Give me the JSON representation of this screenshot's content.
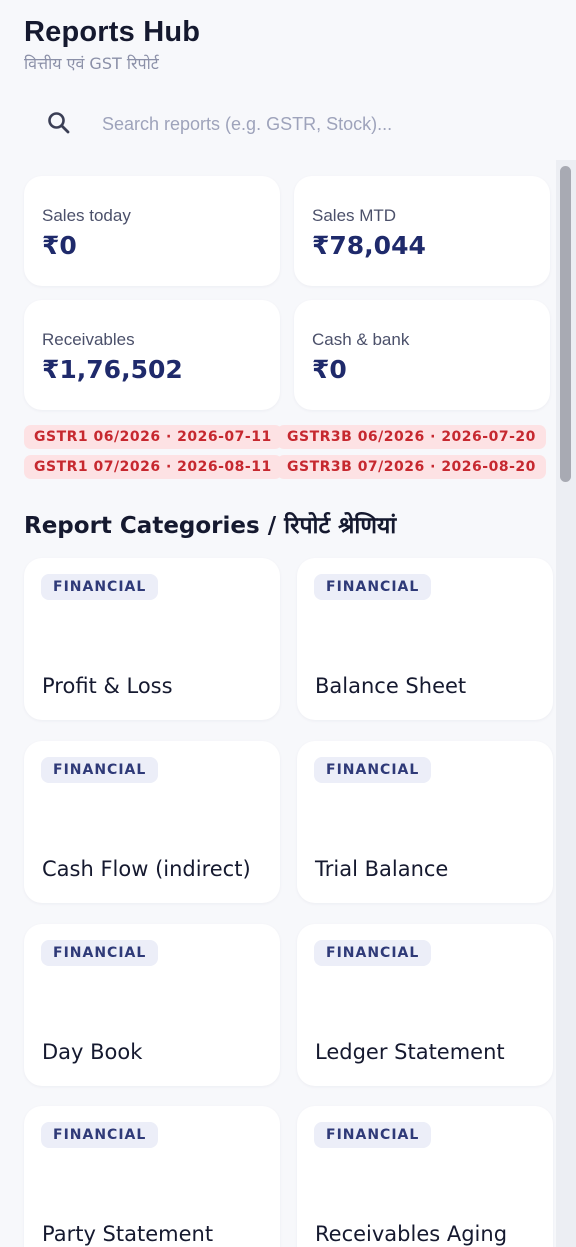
{
  "header": {
    "title": "Reports Hub",
    "subtitle": "वित्तीय एवं GST रिपोर्ट"
  },
  "search": {
    "placeholder": "Search reports (e.g. GSTR, Stock)...",
    "value": ""
  },
  "stats": [
    {
      "label": "Sales today",
      "value": "₹0"
    },
    {
      "label": "Sales MTD",
      "value": "₹78,044"
    },
    {
      "label": "Receivables",
      "value": "₹1,76,502"
    },
    {
      "label": "Cash & bank",
      "value": "₹0"
    }
  ],
  "due_dates": [
    "GSTR1 06/2026 · 2026-07-11",
    "GSTR3B 06/2026 · 2026-07-20",
    "GSTR1 07/2026 · 2026-08-11",
    "GSTR3B 07/2026 · 2026-08-20"
  ],
  "categories": {
    "title": "Report Categories / रिपोर्ट श्रेणियां",
    "reports": [
      {
        "badge": "FINANCIAL",
        "name": "Profit & Loss"
      },
      {
        "badge": "FINANCIAL",
        "name": "Balance Sheet"
      },
      {
        "badge": "FINANCIAL",
        "name": "Cash Flow (indirect)"
      },
      {
        "badge": "FINANCIAL",
        "name": "Trial Balance"
      },
      {
        "badge": "FINANCIAL",
        "name": "Day Book"
      },
      {
        "badge": "FINANCIAL",
        "name": "Ledger Statement"
      },
      {
        "badge": "FINANCIAL",
        "name": "Party Statement"
      },
      {
        "badge": "FINANCIAL",
        "name": "Receivables Aging"
      }
    ]
  },
  "icons": {
    "search": "search-icon"
  },
  "colors": {
    "background": "#f7f8fb",
    "accent": "#1f2a6b",
    "badge_bg": "#eceef8",
    "due_pill_bg": "#fde2e4",
    "due_pill_text": "#c6282f"
  }
}
